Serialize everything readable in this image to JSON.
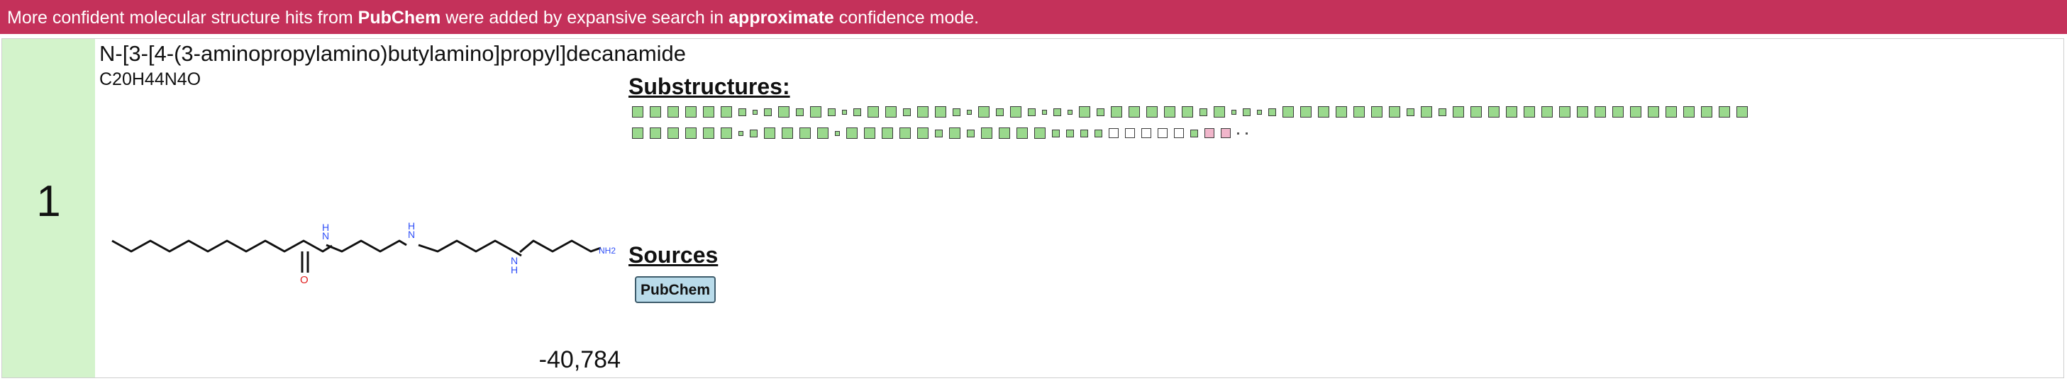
{
  "banner": {
    "text_1": "More confident molecular structure hits from ",
    "source_name": "PubChem",
    "text_2": " were added by expansive search in ",
    "mode": "approximate",
    "text_3": " confidence mode.",
    "color": "#c4315a"
  },
  "result": {
    "rank": "1",
    "name": "N-[3-[4-(3-aminopropylamino)butylamino]propyl]decanamide",
    "formula": "C20H44N4O",
    "score": "-40,784",
    "rank_background": "#d3f3cb",
    "structure_atoms": {
      "nh_label": "H",
      "n_label": "N",
      "o_label": "O",
      "nh2_label": "NH2"
    },
    "substructures": {
      "title": "Substructures:",
      "row1": [
        "L",
        "L",
        "L",
        "L",
        "L",
        "L",
        "M",
        "S",
        "M",
        "L",
        "M",
        "L",
        "M",
        "S",
        "M",
        "L",
        "L",
        "M",
        "L",
        "L",
        "M",
        "S",
        "L",
        "M",
        "L",
        "M",
        "S",
        "M",
        "S",
        "L",
        "M",
        "L",
        "L",
        "L",
        "L",
        "L",
        "M",
        "L",
        "S",
        "M",
        "S",
        "M",
        "L",
        "L",
        "L",
        "L",
        "L",
        "L",
        "L",
        "M",
        "L",
        "M",
        "L",
        "L",
        "L",
        "L",
        "L",
        "L",
        "L",
        "L",
        "L",
        "L",
        "L",
        "L",
        "L",
        "L",
        "L",
        "L",
        "L"
      ],
      "row2": [
        "L",
        "L",
        "L",
        "L",
        "L",
        "L",
        "S",
        "M",
        "L",
        "L",
        "L",
        "L",
        "S",
        "L",
        "L",
        "L",
        "L",
        "L",
        "M",
        "L",
        "M",
        "L",
        "L",
        "L",
        "L",
        "M",
        "M",
        "M",
        "M",
        "W",
        "W",
        "W",
        "W",
        "W",
        "M",
        "P",
        "P",
        "D",
        "D"
      ],
      "colors": {
        "match": "#9ad98d",
        "empty": "#ffffff",
        "warn": "#f1b6cb"
      }
    },
    "sources": {
      "title": "Sources",
      "items": [
        "PubChem"
      ]
    }
  }
}
